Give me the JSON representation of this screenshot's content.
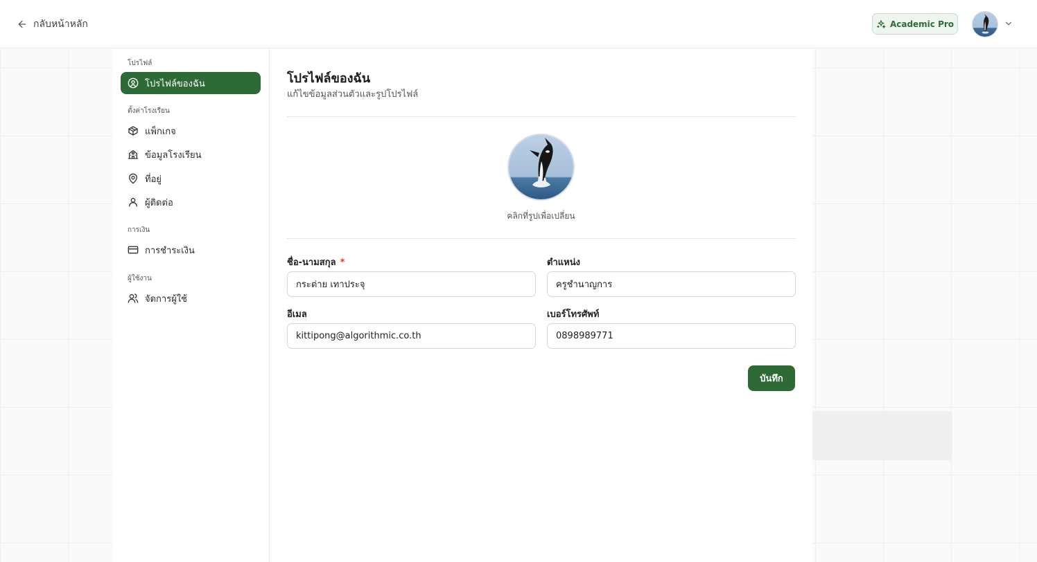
{
  "topbar": {
    "back_label": "กลับหน้าหลัก",
    "plan_badge": "Academic Pro"
  },
  "sidebar": {
    "sections": [
      {
        "label": "โปรไฟล์",
        "items": [
          {
            "label": "โปรไฟล์ของฉัน",
            "icon": "user-circle-icon",
            "active": true
          }
        ]
      },
      {
        "label": "ตั้งค่าโรงเรียน",
        "items": [
          {
            "label": "แพ็กเกจ",
            "icon": "package-icon"
          },
          {
            "label": "ข้อมูลโรงเรียน",
            "icon": "school-icon"
          },
          {
            "label": "ที่อยู่",
            "icon": "map-pin-icon"
          },
          {
            "label": "ผู้ติดต่อ",
            "icon": "user-icon"
          }
        ]
      },
      {
        "label": "การเงิน",
        "items": [
          {
            "label": "การชำระเงิน",
            "icon": "credit-card-icon"
          }
        ]
      },
      {
        "label": "ผู้ใช้งาน",
        "items": [
          {
            "label": "จัดการผู้ใช้",
            "icon": "users-icon"
          }
        ]
      }
    ]
  },
  "main": {
    "title": "โปรไฟล์ของฉัน",
    "subtitle": "แก้ไขข้อมูลส่วนตัวและรูปโปรไฟล์",
    "photo_hint": "คลิกที่รูปเพื่อเปลี่ยน",
    "fields": {
      "name": {
        "label": "ชื่อ-นามสกุล",
        "required_mark": "*",
        "value": "กระต่าย เทาประจุ"
      },
      "position": {
        "label": "ตำแหน่ง",
        "value": "ครูชำนาญการ"
      },
      "email": {
        "label": "อีเมล",
        "value": "kittipong@algorithmic.co.th"
      },
      "phone": {
        "label": "เบอร์โทรศัพท์",
        "value": "0898989771"
      }
    },
    "save_label": "บันทึก"
  },
  "colors": {
    "accent": "#2d6a35",
    "badge_bg": "#eef5ee",
    "required": "#d03b3b"
  }
}
